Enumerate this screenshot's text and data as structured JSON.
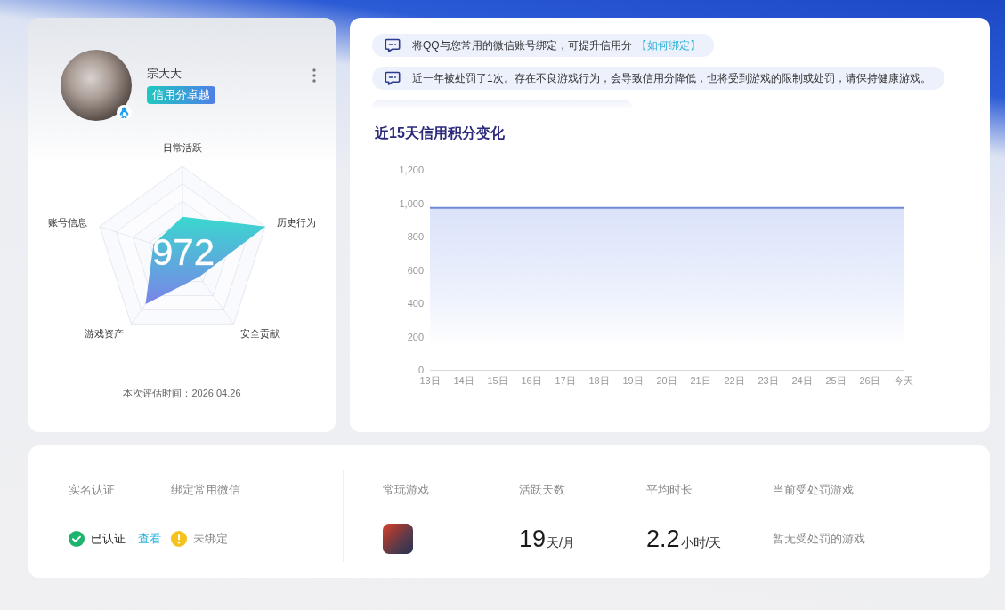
{
  "profile": {
    "name": "宗大大",
    "badge": "信用分卓越",
    "score": "972",
    "radar_labels": [
      "日常活跃",
      "历史行为",
      "安全贡献",
      "游戏资产",
      "账号信息"
    ],
    "evaluated_at": "本次评估时间：2026.04.26"
  },
  "notices": [
    {
      "text": "将QQ与您常用的微信账号绑定，可提升信用分",
      "link": "【如何绑定】"
    },
    {
      "text": "近一年被处罚了1次。存在不良游戏行为，会导致信用分降低，也将受到游戏的限制或处罚，请保持健康游戏。"
    }
  ],
  "notices_cut_off": true,
  "trend": {
    "title": "近15天信用积分变化",
    "chart_data": {
      "type": "area",
      "categories": [
        "13日",
        "14日",
        "15日",
        "16日",
        "17日",
        "18日",
        "19日",
        "20日",
        "21日",
        "22日",
        "23日",
        "24日",
        "25日",
        "26日",
        "今天"
      ],
      "series": [
        {
          "color": "#6e88d8",
          "values": [
            972,
            972,
            972,
            972,
            972,
            972,
            972,
            972,
            972,
            972,
            972,
            972,
            972,
            972,
            972
          ]
        }
      ],
      "ylim": [
        0,
        1200
      ],
      "yticks": [
        {
          "value": 0,
          "label": "0"
        },
        {
          "value": 200,
          "label": "200"
        },
        {
          "value": 400,
          "label": "400"
        },
        {
          "value": 600,
          "label": "600"
        },
        {
          "value": 800,
          "label": "800"
        },
        {
          "value": 1000,
          "label": "1,000"
        },
        {
          "value": 1200,
          "label": "1,200"
        }
      ]
    }
  },
  "verification": [
    {
      "label": "实名认证",
      "kind": "verified",
      "status": "已认证",
      "link": "查看"
    },
    {
      "label": "绑定常用微信",
      "kind": "unbound",
      "status": "未绑定"
    }
  ],
  "game_stats": [
    {
      "label": "常玩游戏",
      "kind": "game_icon"
    },
    {
      "label": "活跃天数",
      "kind": "number",
      "value": "19",
      "unit": "天/月"
    },
    {
      "label": "平均时长",
      "kind": "number",
      "value": "2.2",
      "unit": "小时/天"
    },
    {
      "label": "当前受处罚游戏",
      "kind": "text",
      "value": "暂无受处罚的游戏"
    }
  ]
}
